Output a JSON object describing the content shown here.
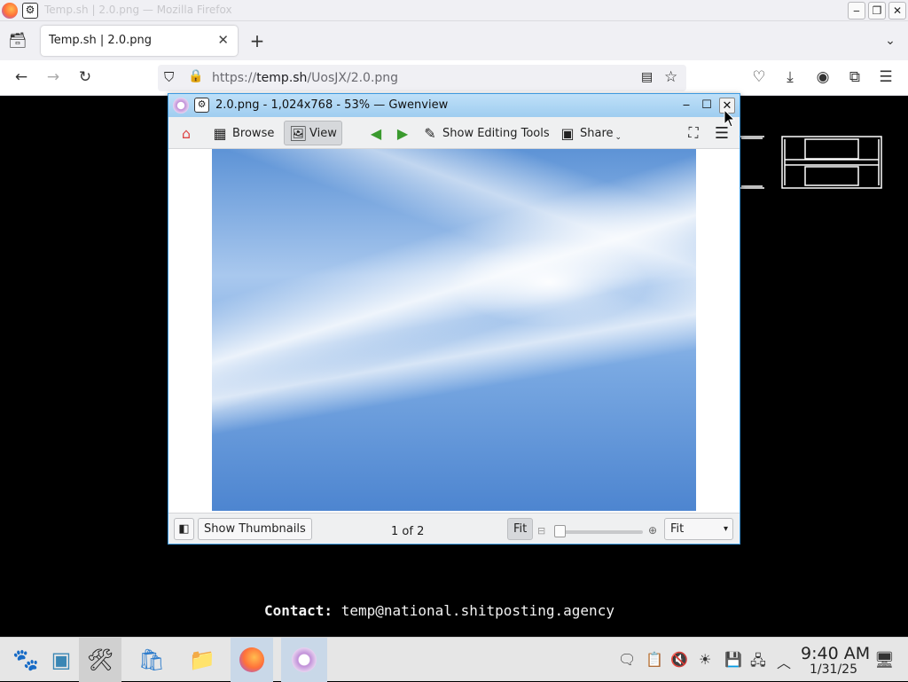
{
  "browser": {
    "window_title": "Temp.sh | 2.0.png — Mozilla Firefox",
    "tab_label": "Temp.sh | 2.0.png",
    "url_prefix": "https://",
    "url_host": "temp.sh",
    "url_path": "/UosJX/2.0.png"
  },
  "page": {
    "contact_label": "Contact:",
    "contact_email": "temp@national.shitposting.agency"
  },
  "gwenview": {
    "title": "2.0.png - 1,024x768 - 53% — Gwenview",
    "browse_label": "Browse",
    "view_label": "View",
    "editing_label": "Show Editing Tools",
    "share_label": "Share",
    "thumbnails_label": "Show Thumbnails",
    "page_counter": "1 of 2",
    "fit_button": "Fit",
    "zoom_select_value": "Fit"
  },
  "taskbar": {
    "clock_time": "9:40 AM",
    "clock_date": "1/31/25"
  },
  "colors": {
    "accent": "#3d9ae0",
    "title_gradient_top": "#bfe0f8"
  }
}
